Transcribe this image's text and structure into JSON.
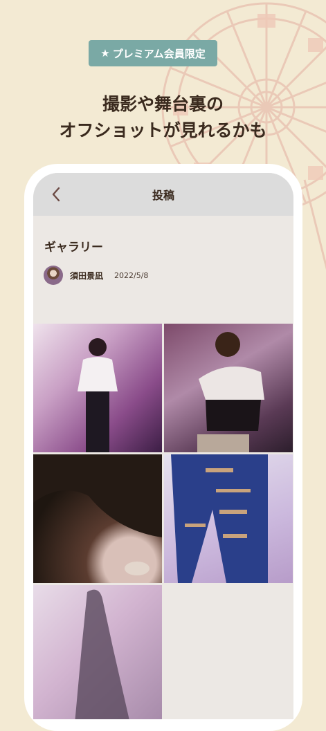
{
  "badge": {
    "icon": "star-icon",
    "star": "★",
    "label": "プレミアム会員限定"
  },
  "headline": {
    "line1": "撮影や舞台裏の",
    "line2": "オフショットが見れるかも"
  },
  "navbar": {
    "title": "投稿",
    "back_icon": "chevron-left-icon"
  },
  "post": {
    "title": "ギャラリー",
    "author": "須田景凪",
    "date": "2022/5/8"
  },
  "gallery": {
    "photo_count": 5
  },
  "colors": {
    "background": "#f3ead3",
    "badge": "#7aa9a5",
    "navbar": "#dcdcdc",
    "screen": "#ece8e4",
    "text": "#3a2a1e",
    "wheel": "#e3b3a0"
  }
}
